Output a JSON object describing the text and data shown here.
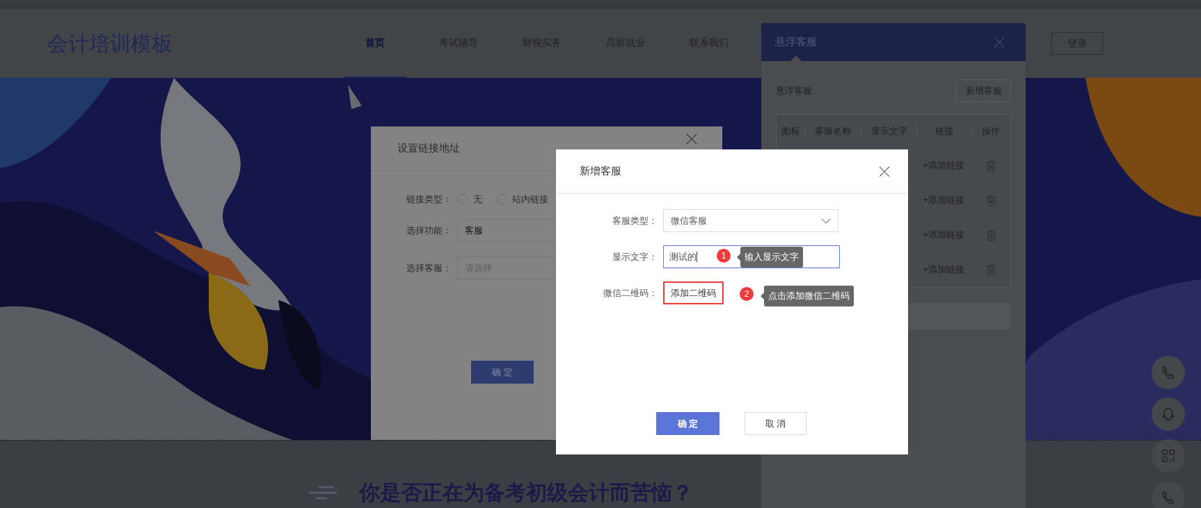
{
  "header": {
    "logo": "会计培训模板",
    "nav": [
      {
        "label": "首页",
        "selected": true
      },
      {
        "label": "考试辅导",
        "selected": false
      },
      {
        "label": "财税实务",
        "selected": false
      },
      {
        "label": "高薪就业",
        "selected": false
      },
      {
        "label": "联系我们",
        "selected": false
      }
    ],
    "login": "登录"
  },
  "section_heading": "你是否正在为备考初级会计而苦恼？",
  "float_buttons": [
    {
      "kind": "phone"
    },
    {
      "kind": "qq"
    },
    {
      "kind": "qr"
    },
    {
      "kind": "phone"
    }
  ],
  "service_panel": {
    "title": "悬浮客服",
    "section_label": "悬浮客服",
    "add_button": "新增客服",
    "columns": [
      "图标",
      "客服名称",
      "显示文字",
      "链接",
      "操作"
    ],
    "rows": [
      {
        "link": "+添加链接"
      },
      {
        "link": "+添加链接"
      },
      {
        "link": "+添加链接"
      },
      {
        "link": "+添加链接"
      }
    ]
  },
  "link_dialog": {
    "title": "设置链接地址",
    "fields": [
      {
        "label": "链接类型：",
        "kind": "radio",
        "options": [
          {
            "label": "无",
            "selected": false
          },
          {
            "label": "站内链接",
            "selected": false
          }
        ]
      },
      {
        "label": "选择功能：",
        "kind": "select",
        "value": "客服"
      },
      {
        "label": "选择客服：",
        "kind": "select",
        "placeholder": "请选择"
      }
    ],
    "confirm": "确 定"
  },
  "add_dialog": {
    "title": "新增客服",
    "fields": [
      {
        "label": "客服类型：",
        "kind": "select",
        "value": "微信客服"
      },
      {
        "label": "显示文字：",
        "kind": "input",
        "value": "测试的",
        "focused": true
      },
      {
        "label": "微信二维码：",
        "kind": "button",
        "button": "添加二维码",
        "highlighted": true
      }
    ],
    "callouts": [
      {
        "number": "1",
        "text": "输入显示文字"
      },
      {
        "number": "2",
        "text": "点击添加微信二维码"
      }
    ],
    "confirm": "确 定",
    "cancel": "取 消"
  }
}
